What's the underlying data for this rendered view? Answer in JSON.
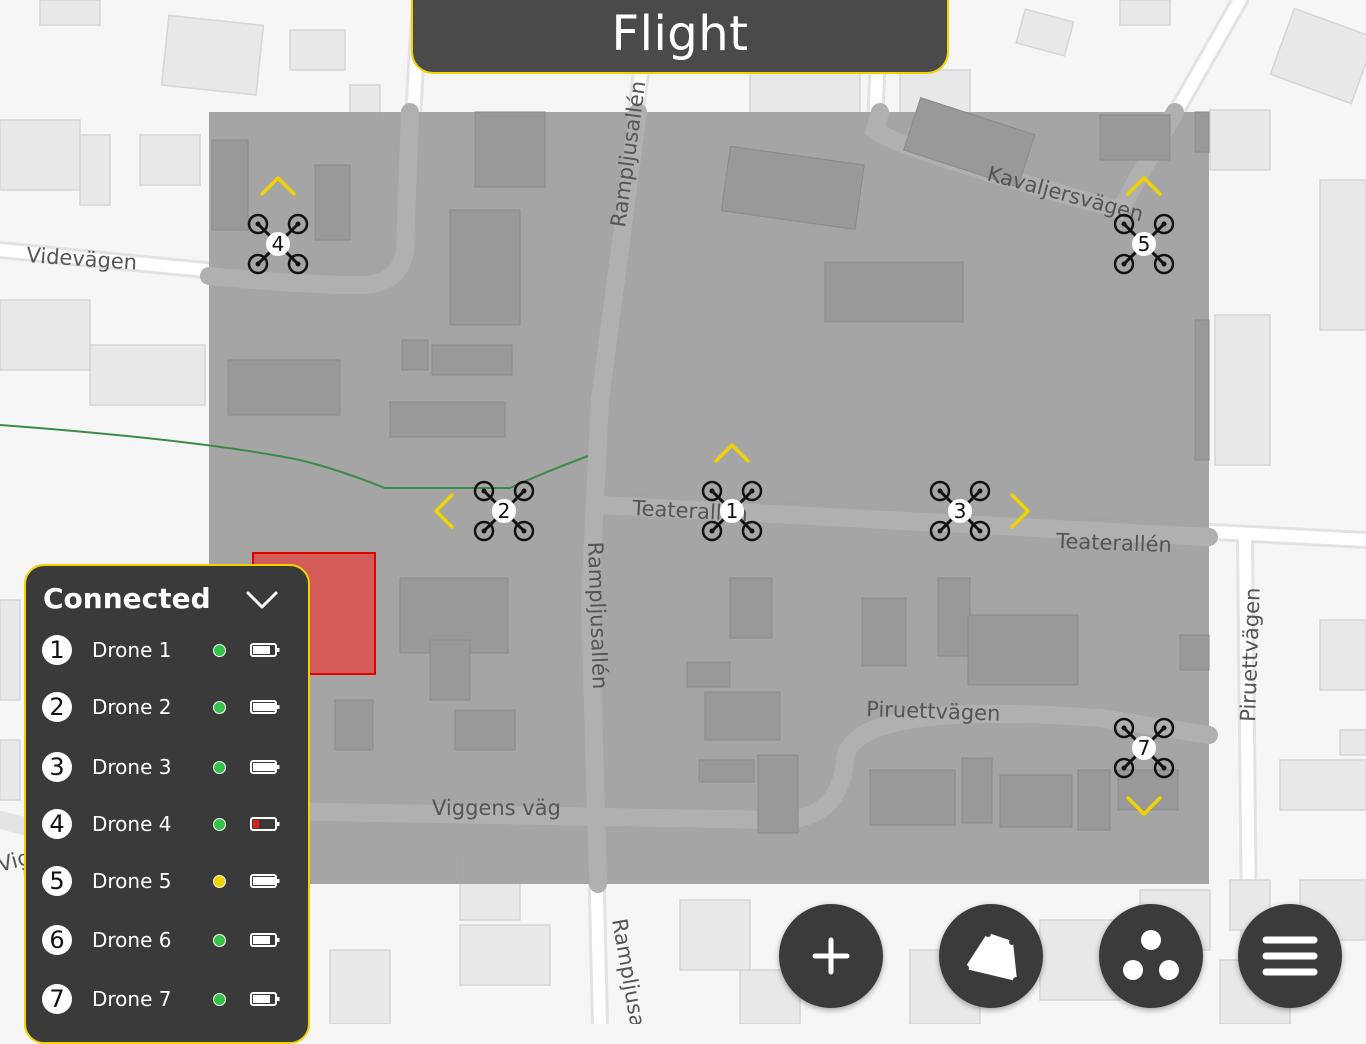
{
  "header": {
    "title": "Flight"
  },
  "map": {
    "roads": [
      "Videvägen",
      "Rampljusallén",
      "Kavaljersvägen",
      "Teaterallén",
      "Teaterallén",
      "Rampljusallén",
      "Piruettvägen",
      "Piruettvägen",
      "Viggens väg",
      "Rampljusallén",
      "Vig"
    ],
    "route_color": "#3c8a4a",
    "area_color": "#a2a2a2",
    "no_fly_color": "#d9534f"
  },
  "drones_on_map": [
    {
      "number": "1",
      "heading": "up"
    },
    {
      "number": "2",
      "heading": "left"
    },
    {
      "number": "3",
      "heading": "right"
    },
    {
      "number": "4",
      "heading": "up"
    },
    {
      "number": "5",
      "heading": "up"
    },
    {
      "number": "7",
      "heading": "down"
    }
  ],
  "connected_panel": {
    "title": "Connected",
    "drones": [
      {
        "number": "1",
        "name": "Drone 1",
        "status": "green",
        "battery": 0.75
      },
      {
        "number": "2",
        "name": "Drone 2",
        "status": "green",
        "battery": 1.0
      },
      {
        "number": "3",
        "name": "Drone 3",
        "status": "green",
        "battery": 1.0
      },
      {
        "number": "4",
        "name": "Drone 4",
        "status": "green",
        "battery": 0.25
      },
      {
        "number": "5",
        "name": "Drone 5",
        "status": "yellow",
        "battery": 1.0
      },
      {
        "number": "6",
        "name": "Drone 6",
        "status": "green",
        "battery": 0.75
      },
      {
        "number": "7",
        "name": "Drone 7",
        "status": "green",
        "battery": 0.75
      }
    ]
  },
  "toolbar": {
    "buttons": [
      {
        "icon": "plus-icon"
      },
      {
        "icon": "area-polygon-icon"
      },
      {
        "icon": "group-drones-icon"
      },
      {
        "icon": "menu-icon"
      }
    ]
  },
  "colors": {
    "accent": "#f2d200",
    "panel_bg": "#3a3a3a",
    "status_green": "#35c24a",
    "status_yellow": "#f2d200",
    "battery_low": "#e02020"
  }
}
